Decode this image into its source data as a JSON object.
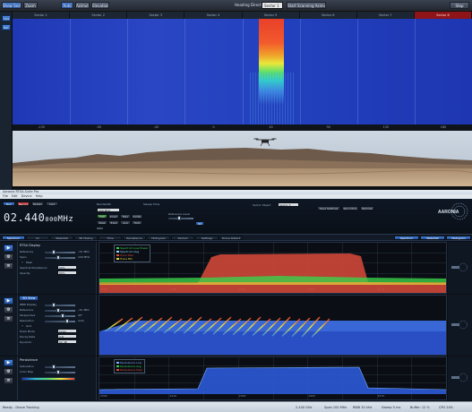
{
  "top_toolbar": {
    "buttons": [
      "Show Sectors",
      "Zoom",
      "Auto",
      "Azimuth",
      "Elevation"
    ],
    "heading_label": "Heading Direction",
    "heading_value": "Sector 1",
    "start_button": "Start Scanning Azimuth",
    "stop_button": "Stop"
  },
  "side_buttons": [
    "Live",
    "Rec"
  ],
  "sectors": [
    "Sector 1",
    "Sector 2",
    "Sector 3",
    "Sector 4",
    "Sector 5",
    "Sector 6",
    "Sector 7",
    "Sector 8"
  ],
  "active_sector": 7,
  "detected_sector": 4,
  "angle_labels": [
    "-135",
    "-90",
    "-45",
    "0",
    "45",
    "90",
    "135",
    "180"
  ],
  "colors": {
    "accent": "#2f6fd0",
    "active_sector": "#8e1418",
    "heat_low": "#1f38b6",
    "heat_high": "#e8402a",
    "trace_green": "#3ad24a",
    "trace_red": "#d94a3a",
    "trace_yellow": "#e3d63a"
  },
  "window": {
    "title": "Aaronia RTSA-Suite Pro",
    "menu": [
      "File",
      "Edit",
      "Device",
      "Help"
    ]
  },
  "controls": {
    "mode_buttons": [
      "Run",
      "Record",
      "Replay",
      "Live"
    ],
    "frequency_value": "02.440",
    "frequency_fine": "000",
    "frequency_unit": "MHz",
    "bandwidth_label": "Bandwidth",
    "bandwidth_value": "100 MHz",
    "span_buttons": [
      "Full",
      "Zoom",
      "Max",
      "Center",
      "Peak",
      "Track",
      "Avg",
      "Hold"
    ],
    "rbw_label": "RBW",
    "sweep_label": "Sweep Time",
    "reference_label": "Reference Level",
    "sector_label": "Sector Object",
    "sector_value": "Sector 5",
    "action_buttons": [
      "Save Settings",
      "Recording",
      "Remote"
    ],
    "logo_text": "AARONIA"
  },
  "tabs": [
    "Spectrum",
    "IQ",
    "Waterfall",
    "3D History",
    "Time",
    "Persistence",
    "Histogram",
    "Demod",
    "Settings",
    "Drone Detect"
  ],
  "tab_right": [
    "Spectrum",
    "Waterfall",
    "Histogram"
  ],
  "panels": [
    {
      "title": "RTSA Display",
      "rows": [
        {
          "label": "Reference",
          "value": "-10 dBm"
        },
        {
          "label": "Span",
          "value": "100 MHz"
        }
      ],
      "check": "Peak",
      "sub_rows": [
        {
          "label": "Spectral Persistence",
          "value": "50%"
        },
        {
          "label": "Opacity",
          "value": "80%"
        }
      ]
    },
    {
      "title": "3D View",
      "rows": [
        {
          "label": "RBW Display",
          "value": ""
        },
        {
          "label": "Reference",
          "value": "-10 dBm"
        },
        {
          "label": "Perspective",
          "value": "45°"
        },
        {
          "label": "Resolution",
          "value": "Auto"
        }
      ],
      "check": "Grid",
      "sub_rows": [
        {
          "label": "Draw Mode",
          "value": "Lines"
        },
        {
          "label": "Decay Rate",
          "value": "0.8"
        },
        {
          "label": "Dynamic",
          "value": "60 dB"
        }
      ]
    },
    {
      "title": "Persistence",
      "rows": [
        {
          "label": "Saturation",
          "value": ""
        },
        {
          "label": "Color Map",
          "value": ""
        }
      ]
    }
  ],
  "legend_top": [
    "Spectrum Low Power",
    "Spectrum Avg",
    "Trace Max",
    "Trace Min"
  ],
  "legend_bottom": [
    "Persistence Low",
    "Persistence Avg",
    "Persistence High"
  ],
  "axis_ticks": [
    "2390",
    "2400",
    "2410",
    "2420",
    "2430",
    "2440",
    "2450",
    "2460",
    "2470",
    "2480",
    "2490"
  ],
  "status": {
    "left": "Ready - Drone Tracking",
    "items": [
      "2.440 GHz",
      "Span 100 MHz",
      "RBW 30 kHz",
      "Sweep 5 ms",
      "Buffer: 12 %",
      "CPU 24%"
    ]
  }
}
